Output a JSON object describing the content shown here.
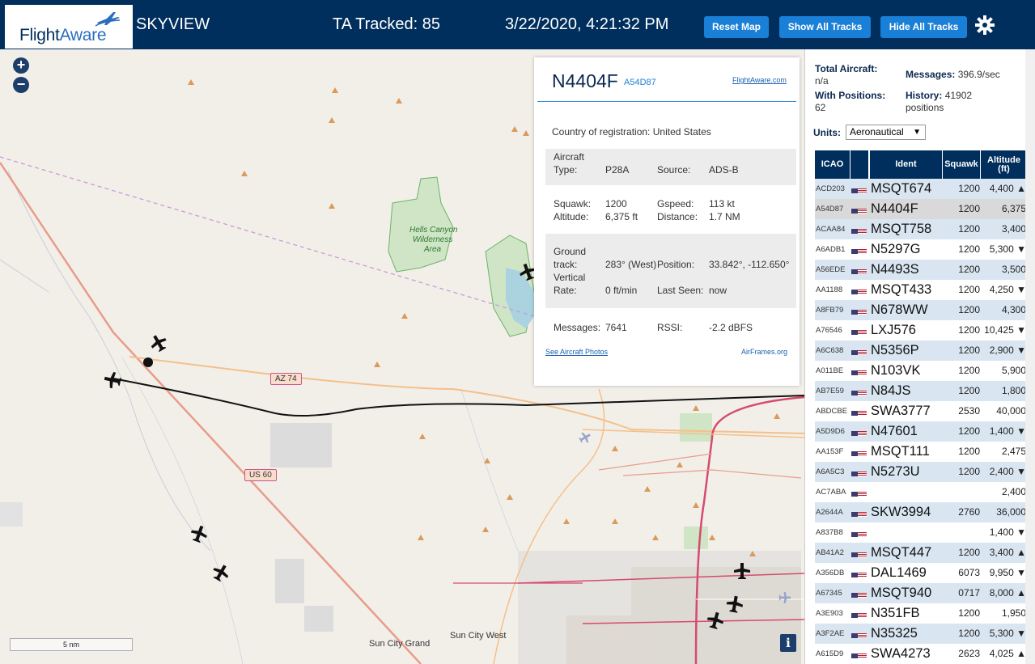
{
  "header": {
    "logo_flight": "Flight",
    "logo_aware": "Aware",
    "app_name": "SKYVIEW",
    "tracked": "TA Tracked: 85",
    "datetime": "3/22/2020, 4:21:32 PM",
    "btn_reset": "Reset Map",
    "btn_show": "Show All Tracks",
    "btn_hide": "Hide All Tracks",
    "settings_icon": "gear-icon"
  },
  "map": {
    "zoom_in": "+",
    "zoom_out": "−",
    "scale_label": "5 nm",
    "info": "i",
    "labels": {
      "hells_canyon": "Hells Canyon",
      "wilderness": "Wilderness",
      "area": "Area",
      "sun_city_grand": "Sun City Grand",
      "sun_city_west": "Sun City West",
      "az74": "AZ 74",
      "us60": "US 60"
    }
  },
  "popup": {
    "ident": "N4404F",
    "hex": "A54D87",
    "fa_link": "FlightAware.com",
    "country_label": "Country of registration:",
    "country": "United States",
    "aircraft_type_label": "Aircraft Type:",
    "aircraft_type": "P28A",
    "source_label": "Source:",
    "source": "ADS-B",
    "squawk_label": "Squawk:",
    "squawk": "1200",
    "gspeed_label": "Gspeed:",
    "gspeed": "113 kt",
    "altitude_label": "Altitude:",
    "altitude": "6,375 ft",
    "distance_label": "Distance:",
    "distance": "1.7 NM",
    "track_label": "Ground track:",
    "track": "283° (West)",
    "position_label": "Position:",
    "position": "33.842°, -112.650°",
    "vrate_label": "Vertical Rate:",
    "vrate": "0 ft/min",
    "lastseen_label": "Last Seen:",
    "lastseen": "now",
    "messages_label": "Messages:",
    "messages": "7641",
    "rssi_label": "RSSI:",
    "rssi": "-2.2 dBFS",
    "photos_link": "See Aircraft Photos",
    "airframes_link": "AirFrames.org"
  },
  "panel": {
    "total_label": "Total Aircraft:",
    "total": "n/a",
    "messages_label": "Messages:",
    "messages": "396.9/sec",
    "with_pos_label": "With Positions:",
    "with_pos": "62",
    "history_label": "History:",
    "history": "41902",
    "history_unit": "positions",
    "units_label": "Units:",
    "units_value": "Aeronautical",
    "columns": {
      "icao": "ICAO",
      "ident": "Ident",
      "squawk": "Squawk",
      "altitude_line1": "Altitude",
      "altitude_line2": "(ft)"
    },
    "rows": [
      {
        "icao": "ACD203",
        "ident": "MSQT674",
        "squawk": "1200",
        "alt": "4,400 ▲"
      },
      {
        "icao": "A54D87",
        "ident": "N4404F",
        "squawk": "1200",
        "alt": "6,375"
      },
      {
        "icao": "ACAA84",
        "ident": "MSQT758",
        "squawk": "1200",
        "alt": "3,400"
      },
      {
        "icao": "A6ADB1",
        "ident": "N5297G",
        "squawk": "1200",
        "alt": "5,300 ▼"
      },
      {
        "icao": "A56EDE",
        "ident": "N4493S",
        "squawk": "1200",
        "alt": "3,500"
      },
      {
        "icao": "AA1188",
        "ident": "MSQT433",
        "squawk": "1200",
        "alt": "4,250 ▼"
      },
      {
        "icao": "A8FB79",
        "ident": "N678WW",
        "squawk": "1200",
        "alt": "4,300"
      },
      {
        "icao": "A76546",
        "ident": "LXJ576",
        "squawk": "1200",
        "alt": "10,425 ▼"
      },
      {
        "icao": "A6C638",
        "ident": "N5356P",
        "squawk": "1200",
        "alt": "2,900 ▼"
      },
      {
        "icao": "A011BE",
        "ident": "N103VK",
        "squawk": "1200",
        "alt": "5,900"
      },
      {
        "icao": "AB7E59",
        "ident": "N84JS",
        "squawk": "1200",
        "alt": "1,800"
      },
      {
        "icao": "ABDCBE",
        "ident": "SWA3777",
        "squawk": "2530",
        "alt": "40,000"
      },
      {
        "icao": "A5D9D6",
        "ident": "N47601",
        "squawk": "1200",
        "alt": "1,400 ▼"
      },
      {
        "icao": "AA153F",
        "ident": "MSQT111",
        "squawk": "1200",
        "alt": "2,475"
      },
      {
        "icao": "A6A5C3",
        "ident": "N5273U",
        "squawk": "1200",
        "alt": "2,400 ▼"
      },
      {
        "icao": "AC7ABA",
        "ident": "",
        "squawk": "",
        "alt": "2,400"
      },
      {
        "icao": "A2644A",
        "ident": "SKW3994",
        "squawk": "2760",
        "alt": "36,000"
      },
      {
        "icao": "A837B8",
        "ident": "",
        "squawk": "",
        "alt": "1,400 ▼"
      },
      {
        "icao": "AB41A2",
        "ident": "MSQT447",
        "squawk": "1200",
        "alt": "3,400 ▲"
      },
      {
        "icao": "A356DB",
        "ident": "DAL1469",
        "squawk": "6073",
        "alt": "9,950 ▼"
      },
      {
        "icao": "A67345",
        "ident": "MSQT940",
        "squawk": "0717",
        "alt": "8,000 ▲"
      },
      {
        "icao": "A3E903",
        "ident": "N351FB",
        "squawk": "1200",
        "alt": "1,950"
      },
      {
        "icao": "A3F2AE",
        "ident": "N35325",
        "squawk": "1200",
        "alt": "5,300 ▼"
      },
      {
        "icao": "A615D9",
        "ident": "SWA4273",
        "squawk": "2623",
        "alt": "4,025 ▲"
      }
    ]
  },
  "colors": {
    "header_bg": "#002f5d",
    "button_bg": "#1a7fd6",
    "row_alt": "#d9e6f2",
    "row_selected": "#d9d9d9"
  }
}
